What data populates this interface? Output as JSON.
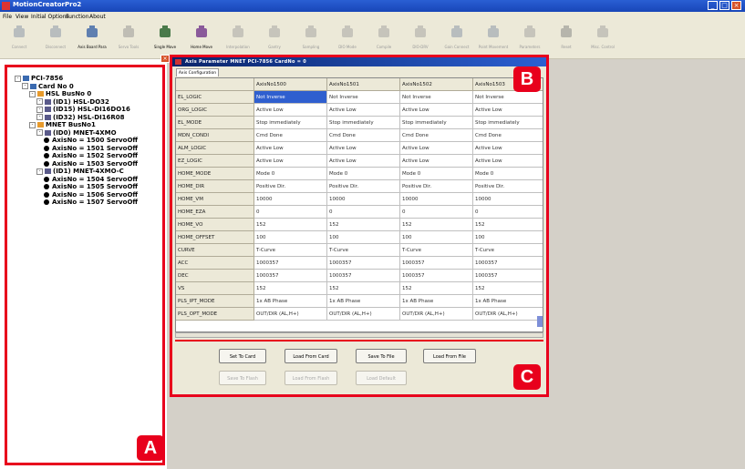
{
  "window": {
    "title": "MotionCreatorPro2",
    "buttons": [
      "_",
      "□",
      "×"
    ]
  },
  "menu": [
    "File",
    "View",
    "Initial Options",
    "Function",
    "About"
  ],
  "toolbar": {
    "items": [
      {
        "label": "Connect",
        "icon": "motor-icon",
        "enabled": false
      },
      {
        "label": "Disconnect",
        "icon": "motor-icon",
        "enabled": false
      },
      {
        "label": "Axis Board Para",
        "icon": "wrench-icon",
        "enabled": true
      },
      {
        "label": "Servo Tools",
        "icon": "gear-icon",
        "enabled": false
      },
      {
        "label": "Single Move",
        "icon": "axis-move-icon",
        "enabled": true
      },
      {
        "label": "Home Move",
        "icon": "home-move-icon",
        "enabled": true
      },
      {
        "label": "Interpolation",
        "icon": "interp-icon",
        "enabled": false
      },
      {
        "label": "Gantry",
        "icon": "gantry-icon",
        "enabled": false
      },
      {
        "label": "Sampling",
        "icon": "sampling-icon",
        "enabled": false
      },
      {
        "label": "DIO Mode",
        "icon": "dio-icon",
        "enabled": false
      },
      {
        "label": "Compile",
        "icon": "compile-icon",
        "enabled": false
      },
      {
        "label": "DIO-DRV",
        "icon": "drv-icon",
        "enabled": false
      },
      {
        "label": "Gain Connect",
        "icon": "motor-icon",
        "enabled": false
      },
      {
        "label": "Point Movement",
        "icon": "motor-icon",
        "enabled": false
      },
      {
        "label": "Parameters",
        "icon": "hand-icon",
        "enabled": false
      },
      {
        "label": "Reset",
        "icon": "reset-icon",
        "enabled": false
      },
      {
        "label": "Misc. Control",
        "icon": "misc-icon",
        "enabled": false
      }
    ]
  },
  "tree": {
    "root": "PCI-7856",
    "nodes": [
      {
        "text": "PCI-7856",
        "level": 0,
        "glyph": "board"
      },
      {
        "text": "Card No 0",
        "level": 1,
        "glyph": "card"
      },
      {
        "text": "HSL BusNo 0",
        "level": 2,
        "glyph": "bus"
      },
      {
        "text": "(ID1) HSL-DO32",
        "level": 3,
        "glyph": "module"
      },
      {
        "text": "(ID15) HSL-DI16DO16",
        "level": 3,
        "glyph": "module"
      },
      {
        "text": "(ID32) HSL-DI16R08",
        "level": 3,
        "glyph": "module"
      },
      {
        "text": "MNET BusNo1",
        "level": 2,
        "glyph": "bus"
      },
      {
        "text": "(ID0) MNET-4XMO",
        "level": 3,
        "glyph": "module"
      },
      {
        "text": "AxisNo = 1500 ServoOff",
        "level": 4,
        "glyph": "dot"
      },
      {
        "text": "AxisNo = 1501 ServoOff",
        "level": 4,
        "glyph": "dot"
      },
      {
        "text": "AxisNo = 1502 ServoOff",
        "level": 4,
        "glyph": "dot"
      },
      {
        "text": "AxisNo = 1503 ServoOff",
        "level": 4,
        "glyph": "dot"
      },
      {
        "text": "(ID1) MNET-4XMO-C",
        "level": 3,
        "glyph": "module"
      },
      {
        "text": "AxisNo = 1504 ServoOff",
        "level": 4,
        "glyph": "dot"
      },
      {
        "text": "AxisNo = 1505 ServoOff",
        "level": 4,
        "glyph": "dot"
      },
      {
        "text": "AxisNo = 1506 ServoOff",
        "level": 4,
        "glyph": "dot"
      },
      {
        "text": "AxisNo = 1507 ServoOff",
        "level": 4,
        "glyph": "dot"
      }
    ]
  },
  "dialog": {
    "title": "Axis Parameter MNET PCI-7856 CardNo = 0",
    "tab": "Axis Configuration",
    "columns": [
      "",
      "AxisNo1500",
      "AxisNo1501",
      "AxisNo1502",
      "AxisNo1503"
    ],
    "rows": [
      [
        "EL_LOGIC",
        "Not Inverse",
        "Not Inverse",
        "Not Inverse",
        "Not Inverse"
      ],
      [
        "ORG_LOGIC",
        "Active Low",
        "Active Low",
        "Active Low",
        "Active Low"
      ],
      [
        "EL_MODE",
        "Stop immediately",
        "Stop immediately",
        "Stop immediately",
        "Stop immediately"
      ],
      [
        "MDN_CONDI",
        "Cmd Done",
        "Cmd Done",
        "Cmd Done",
        "Cmd Done"
      ],
      [
        "ALM_LOGIC",
        "Active Low",
        "Active Low",
        "Active Low",
        "Active Low"
      ],
      [
        "EZ_LOGIC",
        "Active Low",
        "Active Low",
        "Active Low",
        "Active Low"
      ],
      [
        "HOME_MODE",
        "Mode 0",
        "Mode 0",
        "Mode 0",
        "Mode 0"
      ],
      [
        "HOME_DIR",
        "Positive Dir.",
        "Positive Dir.",
        "Positive Dir.",
        "Positive Dir."
      ],
      [
        "HOME_VM",
        "10000",
        "10000",
        "10000",
        "10000"
      ],
      [
        "HOME_EZA",
        "0",
        "0",
        "0",
        "0"
      ],
      [
        "HOME_VO",
        "152",
        "152",
        "152",
        "152"
      ],
      [
        "HOME_OFFSET",
        "100",
        "100",
        "100",
        "100"
      ],
      [
        "CURVE",
        "T-Curve",
        "T-Curve",
        "T-Curve",
        "T-Curve"
      ],
      [
        "ACC",
        "1000357",
        "1000357",
        "1000357",
        "1000357"
      ],
      [
        "DEC",
        "1000357",
        "1000357",
        "1000357",
        "1000357"
      ],
      [
        "VS",
        "152",
        "152",
        "152",
        "152"
      ],
      [
        "PLS_IPT_MODE",
        "1x AB Phase",
        "1x AB Phase",
        "1x AB Phase",
        "1x AB Phase"
      ],
      [
        "PLS_OPT_MODE",
        "OUT/DIR (AL,H+)",
        "OUT/DIR (AL,H+)",
        "OUT/DIR (AL,H+)",
        "OUT/DIR (AL,H+)"
      ]
    ],
    "selected_cell": "EL_LOGIC / AxisNo1500",
    "buttons_row1": [
      "Set To Card",
      "Load From Card",
      "Save To File",
      "Load From File"
    ],
    "buttons_row2": [
      "Save To Flash",
      "Load From Flash",
      "Load Default"
    ]
  },
  "badges": {
    "a": "A",
    "b": "B",
    "c": "C"
  },
  "colors": {
    "highlight": "#e8001c",
    "title_blue": "#1846b8",
    "selection": "#2f5fcf"
  }
}
